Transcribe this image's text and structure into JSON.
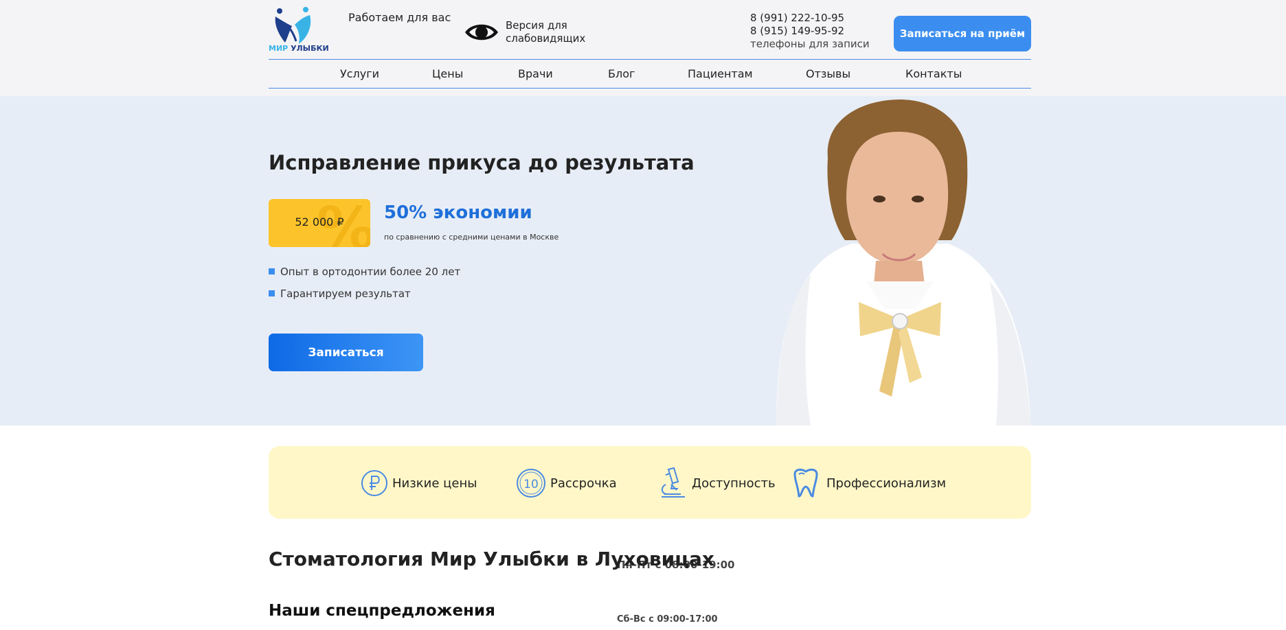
{
  "header": {
    "logo": {
      "part1": "МИР",
      "part2": "УЛЫБКИ"
    },
    "hours": {
      "title": "Работаем для вас",
      "weekdays": "Пн-Пт с 08:00-19:00",
      "weekend": "Сб-Вс с 09:00-17:00"
    },
    "vision": {
      "line1": "Версия для",
      "line2": "слабовидящих"
    },
    "phones": {
      "phone1": "8 (991) 222-10-95",
      "phone2": "8 (915) 149-95-92",
      "note": "телефоны для записи"
    },
    "book_button": "Записаться на приём"
  },
  "nav": [
    {
      "label": "Услуги"
    },
    {
      "label": "Цены"
    },
    {
      "label": "Врачи"
    },
    {
      "label": "Блог"
    },
    {
      "label": "Пациентам"
    },
    {
      "label": "Отзывы"
    },
    {
      "label": "Контакты"
    }
  ],
  "hero": {
    "title": "Исправление прикуса до результата",
    "price": "52 000 ₽",
    "price_bg_glyph": "%",
    "savings_title": "50% экономии",
    "savings_sub": "по сравнению с средними ценами в Москве",
    "bullets": [
      "Опыт в ортодонтии более 20 лет",
      "Гарантируем результат"
    ],
    "cta": "Записаться"
  },
  "features": [
    {
      "icon": "ruble-icon",
      "label": "Низкие цены"
    },
    {
      "icon": "ten-coin-icon",
      "label": "Рассрочка",
      "icon_text": "10"
    },
    {
      "icon": "microscope-icon",
      "label": "Доступность"
    },
    {
      "icon": "tooth-icon",
      "label": "Профессионализм"
    }
  ],
  "sections": {
    "clinic_title": "Стоматология Мир Улыбки в Луховицах",
    "offers_title": "Наши спецпредложения"
  },
  "colors": {
    "accent": "#3b8ef0",
    "brand_dark": "#1f3e8c",
    "brand_light": "#39b3e6",
    "price_yellow": "#fcc42a",
    "features_bg": "#fff7c8",
    "hero_bg": "#e7edf6"
  }
}
